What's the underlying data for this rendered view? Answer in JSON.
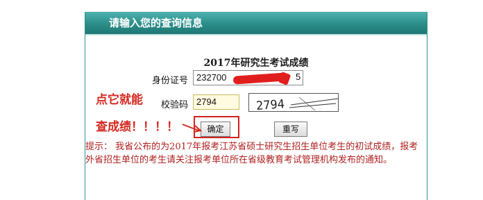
{
  "panel": {
    "header_title": "请输入您的查询信息",
    "form_title": "2017年研究生考试成绩",
    "id_label": "身份证号",
    "id_value_prefix": "232700",
    "id_value_suffix": "5",
    "code_label": "校验码",
    "code_value": "2794",
    "captcha_text": "2794",
    "confirm_label": "确定",
    "reset_label": "重写",
    "hint_text": "提示：  我省公布的为2017年报考江苏省硕士研究生招生单位考生的初试成绩，报考外省招生单位的考生请关注报考单位所在省级教育考试管理机构发布的通知。"
  },
  "annotation": {
    "line1": "点它就能",
    "line2": "查成绩！！！！"
  },
  "colors": {
    "header_bg": "#2b8e8a",
    "annotation": "#d42a22",
    "hint": "#b02020",
    "redaction": "#e11e1e"
  }
}
